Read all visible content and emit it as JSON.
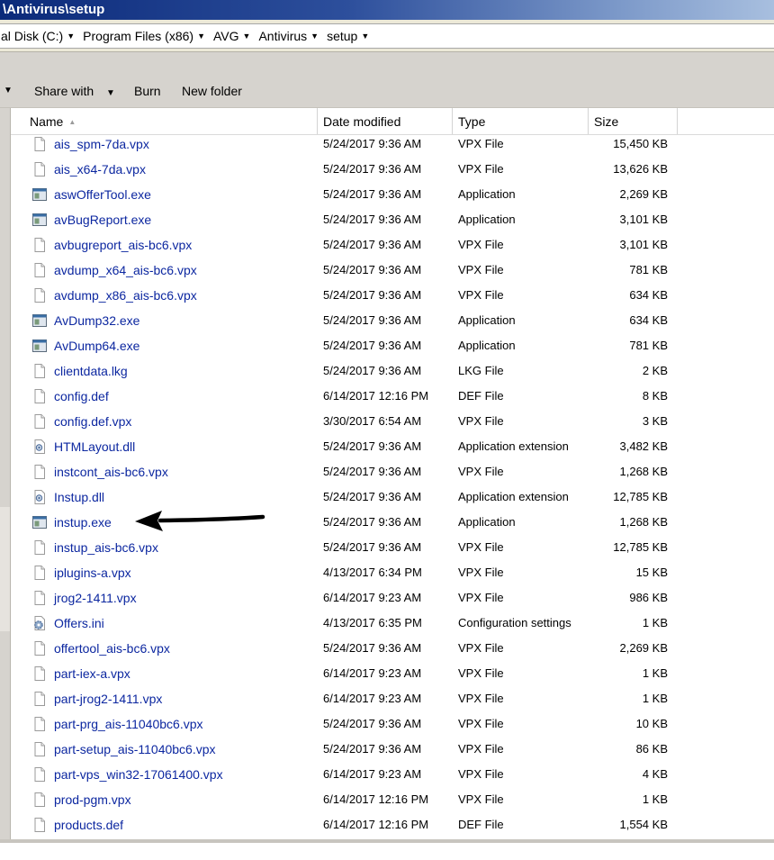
{
  "window": {
    "title": "\\Antivirus\\setup"
  },
  "address": {
    "crumbs": [
      "al Disk (C:)",
      "Program Files (x86)",
      "AVG",
      "Antivirus",
      "setup"
    ],
    "caret": "▼"
  },
  "toolbar": {
    "share_with": "Share with",
    "burn": "Burn",
    "new_folder": "New folder",
    "caret": "▼"
  },
  "columns": {
    "name": "Name",
    "date_modified": "Date modified",
    "type": "Type",
    "size": "Size",
    "sort_indicator": "▲"
  },
  "files": [
    {
      "name": "ais_spm-7da.vpx",
      "date": "5/24/2017 9:36 AM",
      "type": "VPX File",
      "size": "15,450 KB",
      "icon": "file-icon"
    },
    {
      "name": "ais_x64-7da.vpx",
      "date": "5/24/2017 9:36 AM",
      "type": "VPX File",
      "size": "13,626 KB",
      "icon": "file-icon"
    },
    {
      "name": "aswOfferTool.exe",
      "date": "5/24/2017 9:36 AM",
      "type": "Application",
      "size": "2,269 KB",
      "icon": "application-icon"
    },
    {
      "name": "avBugReport.exe",
      "date": "5/24/2017 9:36 AM",
      "type": "Application",
      "size": "3,101 KB",
      "icon": "application-icon"
    },
    {
      "name": "avbugreport_ais-bc6.vpx",
      "date": "5/24/2017 9:36 AM",
      "type": "VPX File",
      "size": "3,101 KB",
      "icon": "file-icon"
    },
    {
      "name": "avdump_x64_ais-bc6.vpx",
      "date": "5/24/2017 9:36 AM",
      "type": "VPX File",
      "size": "781 KB",
      "icon": "file-icon"
    },
    {
      "name": "avdump_x86_ais-bc6.vpx",
      "date": "5/24/2017 9:36 AM",
      "type": "VPX File",
      "size": "634 KB",
      "icon": "file-icon"
    },
    {
      "name": "AvDump32.exe",
      "date": "5/24/2017 9:36 AM",
      "type": "Application",
      "size": "634 KB",
      "icon": "application-icon"
    },
    {
      "name": "AvDump64.exe",
      "date": "5/24/2017 9:36 AM",
      "type": "Application",
      "size": "781 KB",
      "icon": "application-icon"
    },
    {
      "name": "clientdata.lkg",
      "date": "5/24/2017 9:36 AM",
      "type": "LKG File",
      "size": "2 KB",
      "icon": "file-icon"
    },
    {
      "name": "config.def",
      "date": "6/14/2017 12:16 PM",
      "type": "DEF File",
      "size": "8 KB",
      "icon": "file-icon"
    },
    {
      "name": "config.def.vpx",
      "date": "3/30/2017 6:54 AM",
      "type": "VPX File",
      "size": "3 KB",
      "icon": "file-icon"
    },
    {
      "name": "HTMLayout.dll",
      "date": "5/24/2017 9:36 AM",
      "type": "Application extension",
      "size": "3,482 KB",
      "icon": "dll-icon"
    },
    {
      "name": "instcont_ais-bc6.vpx",
      "date": "5/24/2017 9:36 AM",
      "type": "VPX File",
      "size": "1,268 KB",
      "icon": "file-icon"
    },
    {
      "name": "Instup.dll",
      "date": "5/24/2017 9:36 AM",
      "type": "Application extension",
      "size": "12,785 KB",
      "icon": "dll-icon"
    },
    {
      "name": "instup.exe",
      "date": "5/24/2017 9:36 AM",
      "type": "Application",
      "size": "1,268 KB",
      "icon": "application-icon"
    },
    {
      "name": "instup_ais-bc6.vpx",
      "date": "5/24/2017 9:36 AM",
      "type": "VPX File",
      "size": "12,785 KB",
      "icon": "file-icon"
    },
    {
      "name": "iplugins-a.vpx",
      "date": "4/13/2017 6:34 PM",
      "type": "VPX File",
      "size": "15 KB",
      "icon": "file-icon"
    },
    {
      "name": "jrog2-1411.vpx",
      "date": "6/14/2017 9:23 AM",
      "type": "VPX File",
      "size": "986 KB",
      "icon": "file-icon"
    },
    {
      "name": "Offers.ini",
      "date": "4/13/2017 6:35 PM",
      "type": "Configuration settings",
      "size": "1 KB",
      "icon": "settings-file-icon"
    },
    {
      "name": "offertool_ais-bc6.vpx",
      "date": "5/24/2017 9:36 AM",
      "type": "VPX File",
      "size": "2,269 KB",
      "icon": "file-icon"
    },
    {
      "name": "part-iex-a.vpx",
      "date": "6/14/2017 9:23 AM",
      "type": "VPX File",
      "size": "1 KB",
      "icon": "file-icon"
    },
    {
      "name": "part-jrog2-1411.vpx",
      "date": "6/14/2017 9:23 AM",
      "type": "VPX File",
      "size": "1 KB",
      "icon": "file-icon"
    },
    {
      "name": "part-prg_ais-11040bc6.vpx",
      "date": "5/24/2017 9:36 AM",
      "type": "VPX File",
      "size": "10 KB",
      "icon": "file-icon"
    },
    {
      "name": "part-setup_ais-11040bc6.vpx",
      "date": "5/24/2017 9:36 AM",
      "type": "VPX File",
      "size": "86 KB",
      "icon": "file-icon"
    },
    {
      "name": "part-vps_win32-17061400.vpx",
      "date": "6/14/2017 9:23 AM",
      "type": "VPX File",
      "size": "4 KB",
      "icon": "file-icon"
    },
    {
      "name": "prod-pgm.vpx",
      "date": "6/14/2017 12:16 PM",
      "type": "VPX File",
      "size": "1 KB",
      "icon": "file-icon"
    },
    {
      "name": "products.def",
      "date": "6/14/2017 12:16 PM",
      "type": "DEF File",
      "size": "1,554 KB",
      "icon": "file-icon"
    }
  ],
  "annotation": {
    "icon": "pointer-arrow-icon",
    "points_to": "instup.exe",
    "color": "#000000"
  },
  "colors": {
    "filename_link": "#0c27a0",
    "title_bar": "#0b2a7a"
  }
}
